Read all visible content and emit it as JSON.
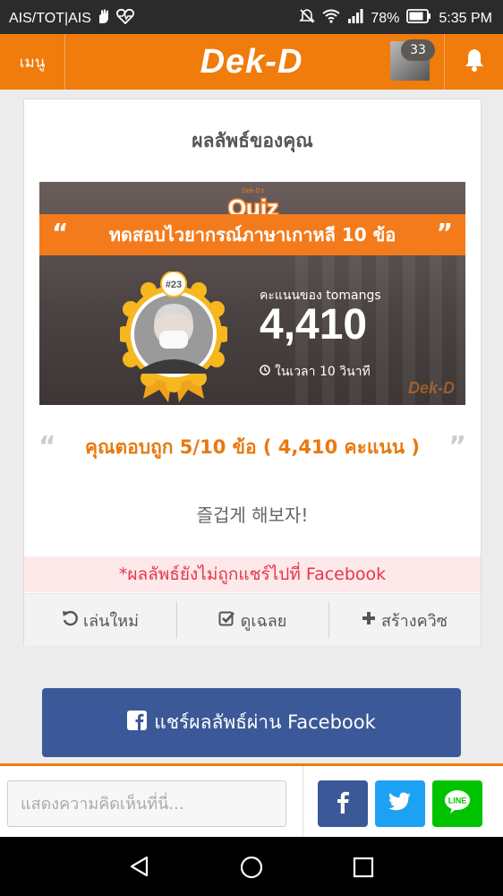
{
  "status_bar": {
    "carrier": "AIS/TOT|AIS",
    "battery_percent": "78%",
    "time": "5:35 PM",
    "icons": [
      "hand-icon",
      "heart-pulse-icon",
      "mute-icon",
      "wifi-icon",
      "signal-icon",
      "battery-icon"
    ]
  },
  "navbar": {
    "menu_label": "เมนู",
    "logo_text": "Dek-D",
    "notification_count": "33",
    "accent_color": "#f07c0b"
  },
  "result_card": {
    "title": "ผลลัพธ์ของคุณ",
    "banner": {
      "brand_small": "Dek-D's",
      "brand_logo": "Quiz",
      "quiz_name": "ทดสอบไวยากรณ์ภาษาเกาหลี 10 ข้อ",
      "rank": "#23",
      "score_label": "คะแนนของ tomangs",
      "score": "4,410",
      "time_label": "ในเวลา 10 วินาที",
      "watermark": "Dek-D"
    },
    "result_text": "คุณตอบถูก 5/10 ข้อ ( 4,410 คะแนน )",
    "sub_text": "즐겁게 해보자!",
    "share_warning": "*ผลลัพธ์ยังไม่ถูกแชร์ไปที่ Facebook",
    "actions": [
      {
        "label": "เล่นใหม่",
        "icon": "replay-icon"
      },
      {
        "label": "ดูเฉลย",
        "icon": "check-square-icon"
      },
      {
        "label": "สร้างควิซ",
        "icon": "plus-icon"
      }
    ]
  },
  "share_button": {
    "label": "แชร์ผลลัพธ์ผ่าน Facebook",
    "color": "#3b5998"
  },
  "comment_bar": {
    "placeholder": "แสดงความคิดเห็นที่นี่...",
    "share_buttons": [
      {
        "name": "facebook",
        "color": "#3b5998",
        "glyph": "f"
      },
      {
        "name": "twitter",
        "color": "#1da1f2"
      },
      {
        "name": "line",
        "color": "#00c300",
        "glyph": "LINE"
      }
    ]
  }
}
